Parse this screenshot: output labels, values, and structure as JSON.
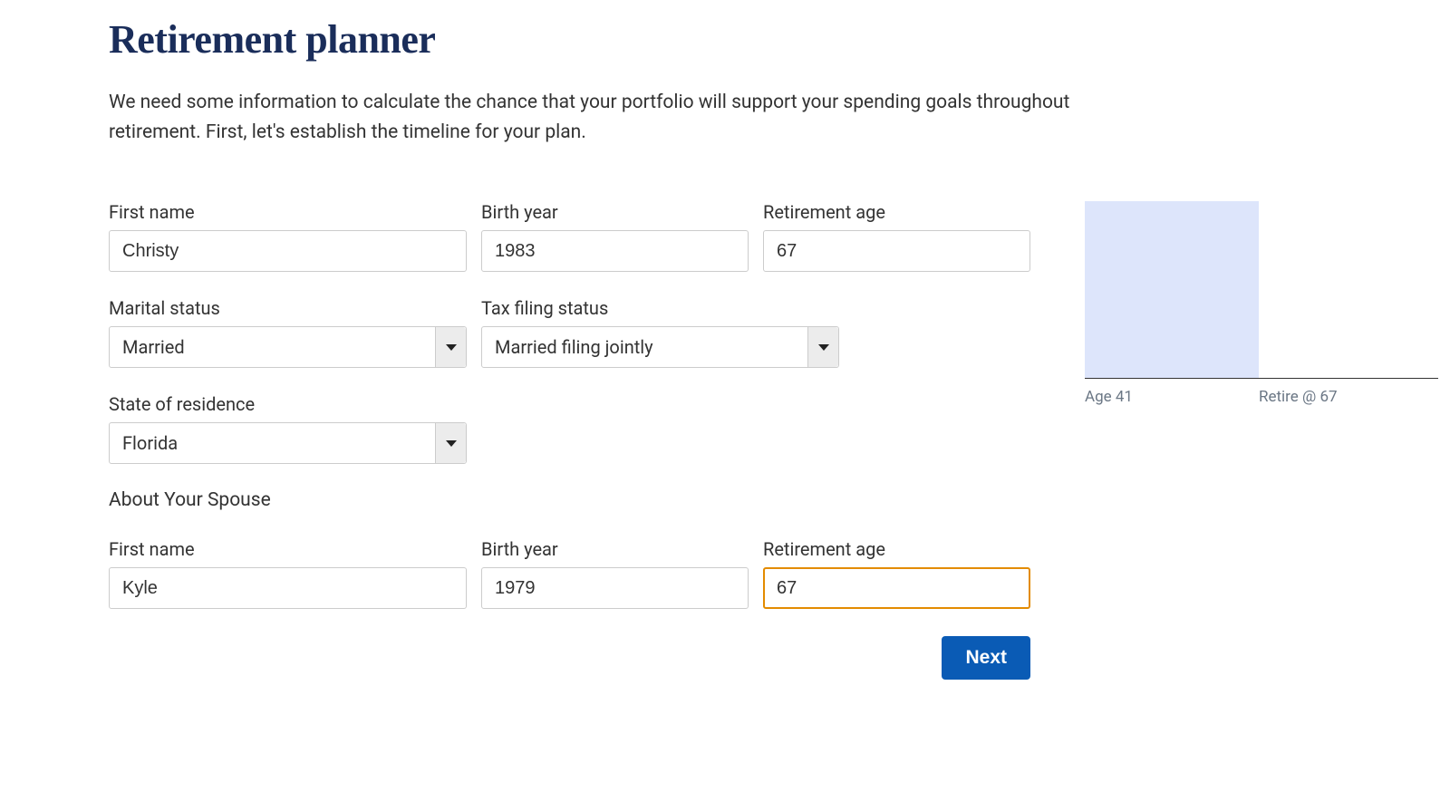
{
  "title": "Retirement planner",
  "intro": "We need some information to calculate the chance that your portfolio will support your spending goals throughout retirement. First, let's establish the timeline for your plan.",
  "labels": {
    "first_name": "First name",
    "birth_year": "Birth year",
    "retirement_age": "Retirement age",
    "marital_status": "Marital status",
    "tax_filing_status": "Tax filing status",
    "state_of_residence": "State of residence",
    "about_spouse": "About Your Spouse"
  },
  "primary": {
    "first_name": "Christy",
    "birth_year": "1983",
    "retirement_age": "67",
    "marital_status": "Married",
    "tax_filing_status": "Married filing jointly",
    "state": "Florida"
  },
  "spouse": {
    "first_name": "Kyle",
    "birth_year": "1979",
    "retirement_age": "67"
  },
  "timeline": {
    "age_label": "Age 41",
    "retire_label": "Retire @ 67"
  },
  "buttons": {
    "next": "Next"
  }
}
